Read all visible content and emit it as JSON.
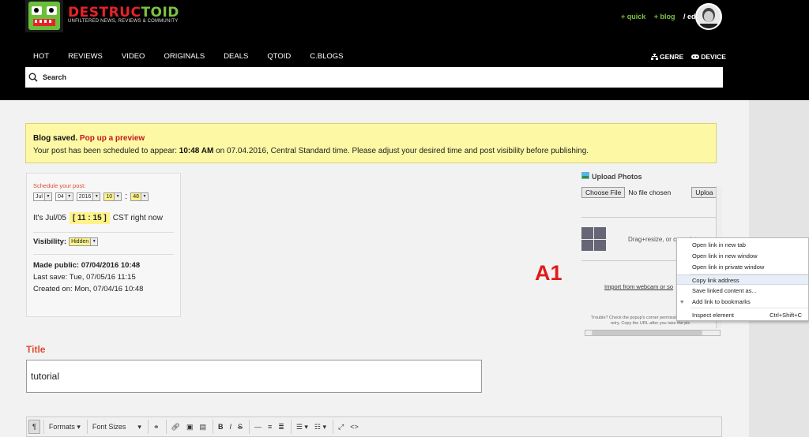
{
  "header": {
    "logo_word_a": "DESTRUC",
    "logo_word_b": "TOID",
    "tagline": "UNFILTERED NEWS, REVIEWS & COMMUNITY",
    "links": [
      "+ quick",
      "+ blog",
      "/ edit"
    ]
  },
  "nav": {
    "items": [
      "HOT",
      "REVIEWS",
      "VIDEO",
      "ORIGINALS",
      "DEALS",
      "QTOID",
      "C.BLOGS"
    ],
    "genre": "GENRE",
    "device": "DEVICE"
  },
  "search": {
    "label": "Search"
  },
  "notice": {
    "saved": "Blog saved.",
    "popup_link": "Pop up a preview",
    "msg_a": "Your post has been scheduled to appear:",
    "time": "10:48 AM",
    "msg_b": "on 07.04.2016, Central Standard time. Please adjust your desired time and post visibility before publishing."
  },
  "schedule": {
    "label": "Schedule your post:",
    "month": "Jul",
    "day": "04",
    "year": "2016",
    "hour": "10",
    "colon": ":",
    "minute": "48",
    "now_prefix": "It's Jul/05",
    "now_time": "[ 11 : 15 ]",
    "now_suffix": "CST right now",
    "visibility_label": "Visibility:",
    "visibility_value": "Hidden",
    "public_label": "Made public:",
    "public_value": "07/04/2016 10:48",
    "lastsave": "Last save:   Tue, 07/05/16 11:15",
    "created": "Created on:   Mon, 07/04/16 10:48"
  },
  "title": {
    "label": "Title",
    "value": "tutorial"
  },
  "toolbar": {
    "formats": "Formats",
    "font_sizes": "Font Sizes"
  },
  "upload": {
    "title": "Upload Photos",
    "choose_btn": "Choose File",
    "no_file": "No file chosen",
    "upload_btn": "Uploa",
    "drag_text": "Drag+resize, or copy+k to",
    "webcam_link": "Import from webcam or so",
    "trouble_text": "Trouble? Check the popup's corner permission, \"close it\", and retry. Copy the URL after you take the pic"
  },
  "context_menu": {
    "open_tab": "Open link in new tab",
    "open_window": "Open link in new window",
    "open_private": "Open link in private window",
    "copy_link": "Copy link address",
    "save_linked": "Save linked content as...",
    "add_bookmark": "Add link to bookmarks",
    "inspect": "Inspect element",
    "inspect_shortcut": "Ctrl+Shift+C"
  },
  "annotation": {
    "label": "A1"
  },
  "colors": {
    "accent_red": "#e14b2f",
    "notice_bg": "#fdf8a4",
    "brand_green": "#7cc242"
  }
}
